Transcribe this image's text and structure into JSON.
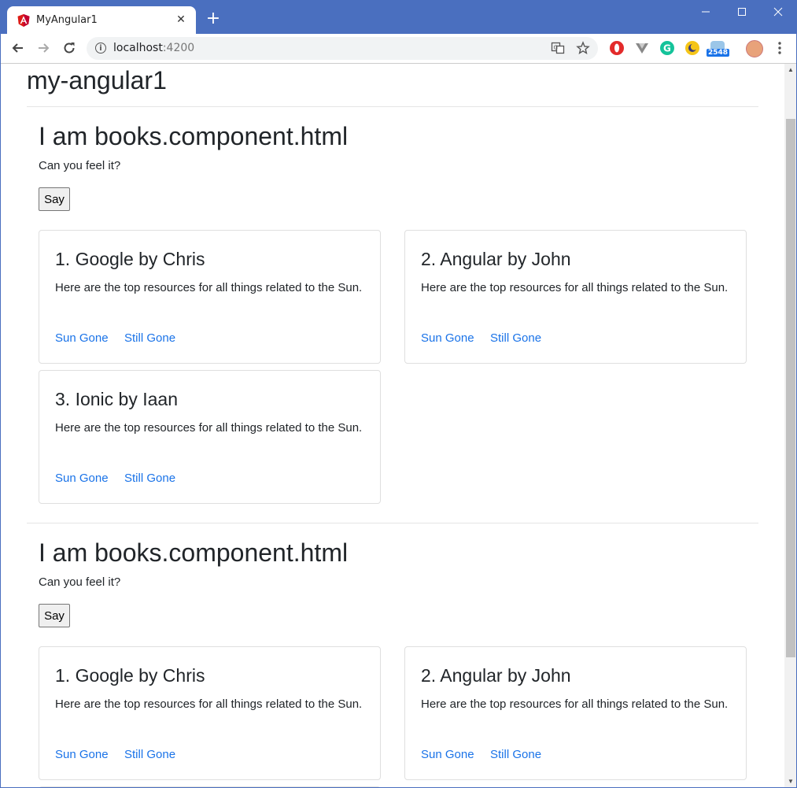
{
  "browser": {
    "tab_title": "MyAngular1",
    "new_tab_label": "+",
    "close_tab_label": "✕",
    "url_host": "localhost",
    "url_port": ":4200",
    "extension_badge": "2548",
    "icons": {
      "favicon": "angular-icon",
      "back": "back-arrow-icon",
      "forward": "forward-arrow-icon",
      "reload": "reload-icon",
      "info": "info-icon",
      "translate": "translate-icon",
      "bookmark": "star-icon",
      "menu": "kebab-menu-icon"
    },
    "colors": {
      "titlebar": "#4a6fbf",
      "link": "#1a73e8"
    }
  },
  "app": {
    "title": "my-angular1"
  },
  "sections": [
    {
      "title": "I am books.component.html",
      "subtitle": "Can you feel it?",
      "button_label": "Say",
      "cards": [
        {
          "title": "1. Google by Chris",
          "text": "Here are the top resources for all things related to the Sun.",
          "link1": "Sun Gone",
          "link2": "Still Gone"
        },
        {
          "title": "2. Angular by John",
          "text": "Here are the top resources for all things related to the Sun.",
          "link1": "Sun Gone",
          "link2": "Still Gone"
        },
        {
          "title": "3. Ionic by Iaan",
          "text": "Here are the top resources for all things related to the Sun.",
          "link1": "Sun Gone",
          "link2": "Still Gone"
        }
      ]
    },
    {
      "title": "I am books.component.html",
      "subtitle": "Can you feel it?",
      "button_label": "Say",
      "cards": [
        {
          "title": "1. Google by Chris",
          "text": "Here are the top resources for all things related to the Sun.",
          "link1": "Sun Gone",
          "link2": "Still Gone"
        },
        {
          "title": "2. Angular by John",
          "text": "Here are the top resources for all things related to the Sun.",
          "link1": "Sun Gone",
          "link2": "Still Gone"
        }
      ]
    }
  ]
}
